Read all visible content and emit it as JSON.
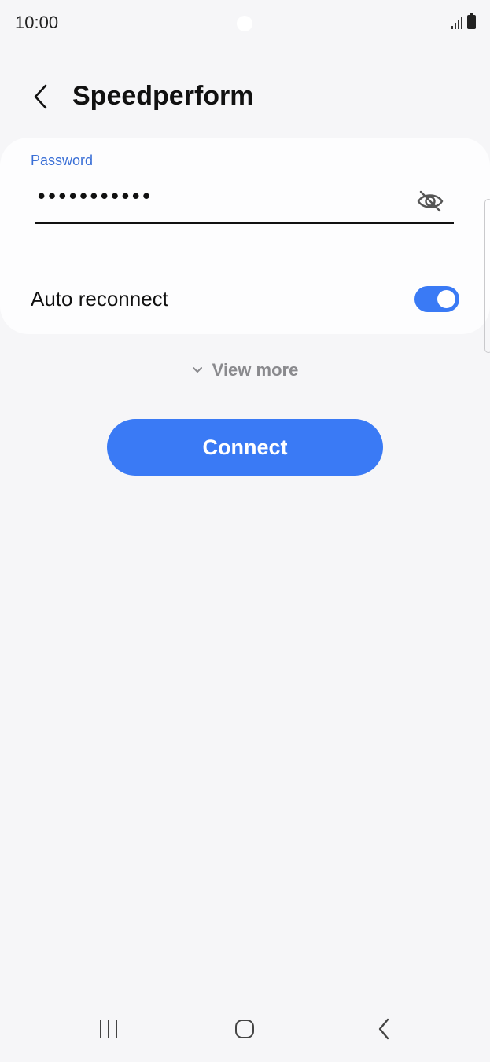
{
  "status_bar": {
    "time": "10:00",
    "icons": [
      "signal-icon",
      "battery-icon"
    ]
  },
  "header": {
    "back_icon": "chevron-left-icon",
    "title": "Speedperform"
  },
  "password": {
    "label": "Password",
    "masked_value": "•••••••••••",
    "visibility_icon": "eye-off-icon"
  },
  "auto_reconnect": {
    "label": "Auto reconnect",
    "enabled": true
  },
  "view_more": {
    "icon": "chevron-down-icon",
    "label": "View more"
  },
  "connect_button": {
    "label": "Connect"
  },
  "nav_bar": {
    "icons": [
      "recents-icon",
      "home-icon",
      "back-icon"
    ]
  },
  "colors": {
    "accent": "#3a7af5",
    "label_blue": "#3a6fd6",
    "background": "#f6f6f8",
    "card": "#fdfdfe",
    "muted_text": "#8a8a8e"
  }
}
